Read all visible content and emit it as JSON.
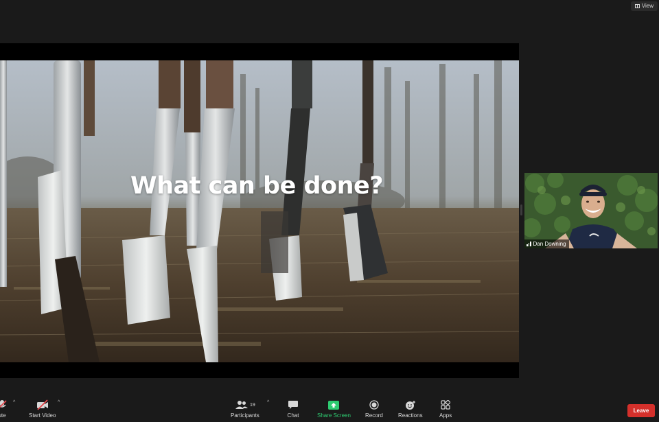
{
  "top_bar": {
    "view_label": "View"
  },
  "share": {
    "slide_title": "What can be done?"
  },
  "participant_tile": {
    "name": "Dan Downing"
  },
  "toolbar": {
    "mute_label": "ute",
    "start_video_label": "Start Video",
    "participants_label": "Participants",
    "participants_count": "19",
    "chat_label": "Chat",
    "share_screen_label": "Share Screen",
    "record_label": "Record",
    "reactions_label": "Reactions",
    "apps_label": "Apps",
    "leave_label": "Leave"
  },
  "colors": {
    "background": "#1a1a1a",
    "share_accent": "#2ecc71",
    "leave": "#d4302b",
    "mute_red": "#e5484d"
  }
}
